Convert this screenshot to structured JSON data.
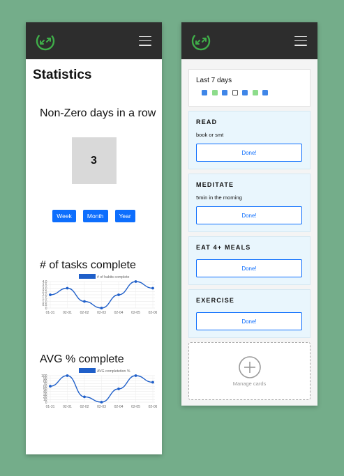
{
  "left": {
    "title": "Statistics",
    "nonzero_title": "Non-Zero days in a row",
    "nonzero_value": "3",
    "range_buttons": [
      "Week",
      "Month",
      "Year"
    ],
    "tasks_title": "# of tasks complete",
    "avg_title": "AVG % complete"
  },
  "right": {
    "last7_title": "Last 7 days",
    "last7_days": [
      "#3f86e8",
      "#8ddc8b",
      "#3f86e8",
      "#ffffff",
      "#3f86e8",
      "#8ddc8b",
      "#3f86e8"
    ],
    "tasks": [
      {
        "name": "READ",
        "desc": "book or smt",
        "button": "Done!"
      },
      {
        "name": "MEDITATE",
        "desc": "5min in the morning",
        "button": "Done!"
      },
      {
        "name": "EAT 4+ MEALS",
        "desc": "",
        "button": "Done!"
      },
      {
        "name": "EXERCISE",
        "desc": "",
        "button": "Done!"
      }
    ],
    "manage_label": "Manage cards"
  },
  "icons": {
    "logo": "refresh-cycle-icon",
    "menu": "hamburger-menu-icon",
    "add": "plus-circle-icon"
  },
  "colors": {
    "accent": "#0d6efd",
    "topbar": "#2d2d2d",
    "logo_green": "#3fae49",
    "card_bg": "#e9f6fd"
  },
  "chart_data": [
    {
      "type": "line",
      "legend": "# of habits complete",
      "x": [
        "01-31",
        "02-01",
        "02-02",
        "02-03",
        "02-04",
        "02-05",
        "02-06"
      ],
      "y": [
        2,
        3,
        1,
        0,
        2,
        4,
        3
      ],
      "ylim": [
        0,
        4
      ],
      "yticks": [
        "4.0",
        "3.5",
        "3.0",
        "2.5",
        "2.0",
        "1.5",
        "1.0",
        "0.5",
        "0"
      ],
      "legend_position": "top",
      "grid": true
    },
    {
      "type": "line",
      "legend": "AVG completetion %",
      "x": [
        "01-31",
        "02-01",
        "02-02",
        "02-03",
        "02-04",
        "02-05",
        "02-06"
      ],
      "y": [
        60,
        100,
        20,
        0,
        50,
        100,
        75
      ],
      "ylim": [
        0,
        100
      ],
      "yticks": [
        "100",
        "90",
        "80",
        "70",
        "60",
        "50",
        "40",
        "30",
        "20",
        "10",
        "0"
      ],
      "legend_position": "top",
      "grid": true
    }
  ]
}
